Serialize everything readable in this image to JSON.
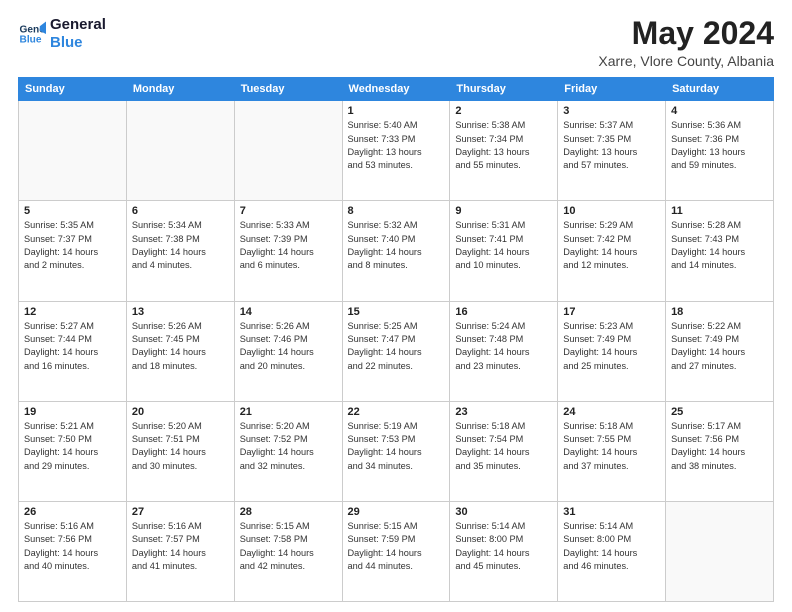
{
  "header": {
    "logo_line1": "General",
    "logo_line2": "Blue",
    "month": "May 2024",
    "location": "Xarre, Vlore County, Albania"
  },
  "weekdays": [
    "Sunday",
    "Monday",
    "Tuesday",
    "Wednesday",
    "Thursday",
    "Friday",
    "Saturday"
  ],
  "weeks": [
    [
      {
        "day": "",
        "info": ""
      },
      {
        "day": "",
        "info": ""
      },
      {
        "day": "",
        "info": ""
      },
      {
        "day": "1",
        "info": "Sunrise: 5:40 AM\nSunset: 7:33 PM\nDaylight: 13 hours\nand 53 minutes."
      },
      {
        "day": "2",
        "info": "Sunrise: 5:38 AM\nSunset: 7:34 PM\nDaylight: 13 hours\nand 55 minutes."
      },
      {
        "day": "3",
        "info": "Sunrise: 5:37 AM\nSunset: 7:35 PM\nDaylight: 13 hours\nand 57 minutes."
      },
      {
        "day": "4",
        "info": "Sunrise: 5:36 AM\nSunset: 7:36 PM\nDaylight: 13 hours\nand 59 minutes."
      }
    ],
    [
      {
        "day": "5",
        "info": "Sunrise: 5:35 AM\nSunset: 7:37 PM\nDaylight: 14 hours\nand 2 minutes."
      },
      {
        "day": "6",
        "info": "Sunrise: 5:34 AM\nSunset: 7:38 PM\nDaylight: 14 hours\nand 4 minutes."
      },
      {
        "day": "7",
        "info": "Sunrise: 5:33 AM\nSunset: 7:39 PM\nDaylight: 14 hours\nand 6 minutes."
      },
      {
        "day": "8",
        "info": "Sunrise: 5:32 AM\nSunset: 7:40 PM\nDaylight: 14 hours\nand 8 minutes."
      },
      {
        "day": "9",
        "info": "Sunrise: 5:31 AM\nSunset: 7:41 PM\nDaylight: 14 hours\nand 10 minutes."
      },
      {
        "day": "10",
        "info": "Sunrise: 5:29 AM\nSunset: 7:42 PM\nDaylight: 14 hours\nand 12 minutes."
      },
      {
        "day": "11",
        "info": "Sunrise: 5:28 AM\nSunset: 7:43 PM\nDaylight: 14 hours\nand 14 minutes."
      }
    ],
    [
      {
        "day": "12",
        "info": "Sunrise: 5:27 AM\nSunset: 7:44 PM\nDaylight: 14 hours\nand 16 minutes."
      },
      {
        "day": "13",
        "info": "Sunrise: 5:26 AM\nSunset: 7:45 PM\nDaylight: 14 hours\nand 18 minutes."
      },
      {
        "day": "14",
        "info": "Sunrise: 5:26 AM\nSunset: 7:46 PM\nDaylight: 14 hours\nand 20 minutes."
      },
      {
        "day": "15",
        "info": "Sunrise: 5:25 AM\nSunset: 7:47 PM\nDaylight: 14 hours\nand 22 minutes."
      },
      {
        "day": "16",
        "info": "Sunrise: 5:24 AM\nSunset: 7:48 PM\nDaylight: 14 hours\nand 23 minutes."
      },
      {
        "day": "17",
        "info": "Sunrise: 5:23 AM\nSunset: 7:49 PM\nDaylight: 14 hours\nand 25 minutes."
      },
      {
        "day": "18",
        "info": "Sunrise: 5:22 AM\nSunset: 7:49 PM\nDaylight: 14 hours\nand 27 minutes."
      }
    ],
    [
      {
        "day": "19",
        "info": "Sunrise: 5:21 AM\nSunset: 7:50 PM\nDaylight: 14 hours\nand 29 minutes."
      },
      {
        "day": "20",
        "info": "Sunrise: 5:20 AM\nSunset: 7:51 PM\nDaylight: 14 hours\nand 30 minutes."
      },
      {
        "day": "21",
        "info": "Sunrise: 5:20 AM\nSunset: 7:52 PM\nDaylight: 14 hours\nand 32 minutes."
      },
      {
        "day": "22",
        "info": "Sunrise: 5:19 AM\nSunset: 7:53 PM\nDaylight: 14 hours\nand 34 minutes."
      },
      {
        "day": "23",
        "info": "Sunrise: 5:18 AM\nSunset: 7:54 PM\nDaylight: 14 hours\nand 35 minutes."
      },
      {
        "day": "24",
        "info": "Sunrise: 5:18 AM\nSunset: 7:55 PM\nDaylight: 14 hours\nand 37 minutes."
      },
      {
        "day": "25",
        "info": "Sunrise: 5:17 AM\nSunset: 7:56 PM\nDaylight: 14 hours\nand 38 minutes."
      }
    ],
    [
      {
        "day": "26",
        "info": "Sunrise: 5:16 AM\nSunset: 7:56 PM\nDaylight: 14 hours\nand 40 minutes."
      },
      {
        "day": "27",
        "info": "Sunrise: 5:16 AM\nSunset: 7:57 PM\nDaylight: 14 hours\nand 41 minutes."
      },
      {
        "day": "28",
        "info": "Sunrise: 5:15 AM\nSunset: 7:58 PM\nDaylight: 14 hours\nand 42 minutes."
      },
      {
        "day": "29",
        "info": "Sunrise: 5:15 AM\nSunset: 7:59 PM\nDaylight: 14 hours\nand 44 minutes."
      },
      {
        "day": "30",
        "info": "Sunrise: 5:14 AM\nSunset: 8:00 PM\nDaylight: 14 hours\nand 45 minutes."
      },
      {
        "day": "31",
        "info": "Sunrise: 5:14 AM\nSunset: 8:00 PM\nDaylight: 14 hours\nand 46 minutes."
      },
      {
        "day": "",
        "info": ""
      }
    ]
  ]
}
